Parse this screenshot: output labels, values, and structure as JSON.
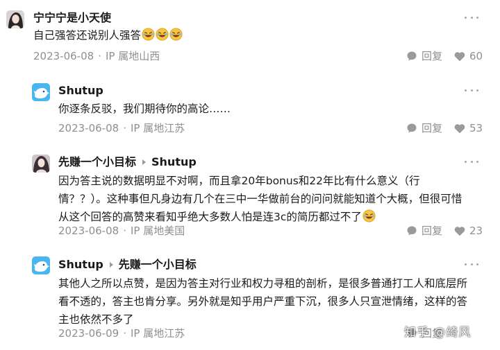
{
  "colors": {
    "text": "#1a1a1a",
    "meta": "#8f8f8f",
    "icon": "#9a9a9a",
    "bird_avatar": "#49b6f0"
  },
  "comments": [
    {
      "author": "宁宁宁是小天使",
      "reply_to": "",
      "avatar_icon": "portrait-avatar-icon",
      "lines": [
        "自己强答还说别人强答"
      ],
      "emoji_count": 3,
      "date": "2023-06-08",
      "location": "IP 属地山西",
      "reply_label": "回复",
      "likes": "60"
    },
    {
      "author": "Shutup",
      "reply_to": "",
      "avatar_icon": "bird-avatar-icon",
      "lines": [
        "你逐条反驳，我们期待你的高论……"
      ],
      "emoji_count": 0,
      "date": "2023-06-08",
      "location": "IP 属地江苏",
      "reply_label": "回复",
      "likes": "53"
    },
    {
      "author": "先赚一个小目标",
      "reply_to": "Shutup",
      "avatar_icon": "portrait-avatar-icon",
      "lines": [
        "因为答主说的数据明显不对啊，而且拿20年bonus和22年比有什么意义（行",
        "情？？）。这种事但凡身边有几个在三中一华做前台的问问就能知道个大概，但很可惜",
        "从这个回答的高赞来看知乎绝大多数人怕是连3c的简历都过不了"
      ],
      "emoji_count": 1,
      "date": "2023-06-08",
      "location": "IP 属地美国",
      "reply_label": "回复",
      "likes": "23"
    },
    {
      "author": "Shutup",
      "reply_to": "先赚一个小目标",
      "avatar_icon": "bird-avatar-icon",
      "lines": [
        "其他人之所以点赞，是因为答主对行业和权力寻租的剖析，是很多普通打工人和底层所",
        "看不透的，答主也肯分享。另外就是知乎用户严重下沉，很多人只宣泄情绪，这样的答",
        "主也依然不多了"
      ],
      "emoji_count": 0,
      "date": "2023-06-09",
      "location": "IP 属地江苏",
      "reply_label": "回复",
      "likes": ""
    }
  ],
  "watermark": "知乎 @绮风"
}
